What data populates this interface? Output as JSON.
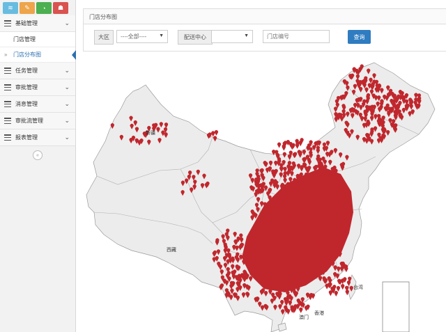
{
  "sidebar": {
    "shortcuts": [
      {
        "icon": "signal-icon",
        "color": "#68bce0",
        "glyph": "≋"
      },
      {
        "icon": "edit-icon",
        "color": "#eea44a",
        "glyph": "✎"
      },
      {
        "icon": "pie-chart-icon",
        "color": "#4caf50",
        "glyph": "◔"
      },
      {
        "icon": "user-icon",
        "color": "#d9534f",
        "glyph": "☗"
      }
    ],
    "menu": {
      "basic": "基础管理",
      "store_mgmt": "门店管理",
      "store_map": "门店分布图",
      "task": "任务管理",
      "approval": "审批管理",
      "message": "消息管理",
      "workflow": "审批流管理",
      "report": "报表管理"
    }
  },
  "panel": {
    "title": "门店分布图"
  },
  "filters": {
    "region_label": "大区",
    "region_value": "----全部----",
    "center_label": "配送中心",
    "center_value": "",
    "store_placeholder": "门店编号",
    "query_button": "查询"
  },
  "map": {
    "labels": {
      "xinjiang": "新疆",
      "tibet": "西藏",
      "taiwan": "台湾",
      "macau": "澳门",
      "hongkong": "香港"
    },
    "marker_color": "#c0272d",
    "land_color": "#ececec",
    "border_color": "#9a9a9a"
  }
}
